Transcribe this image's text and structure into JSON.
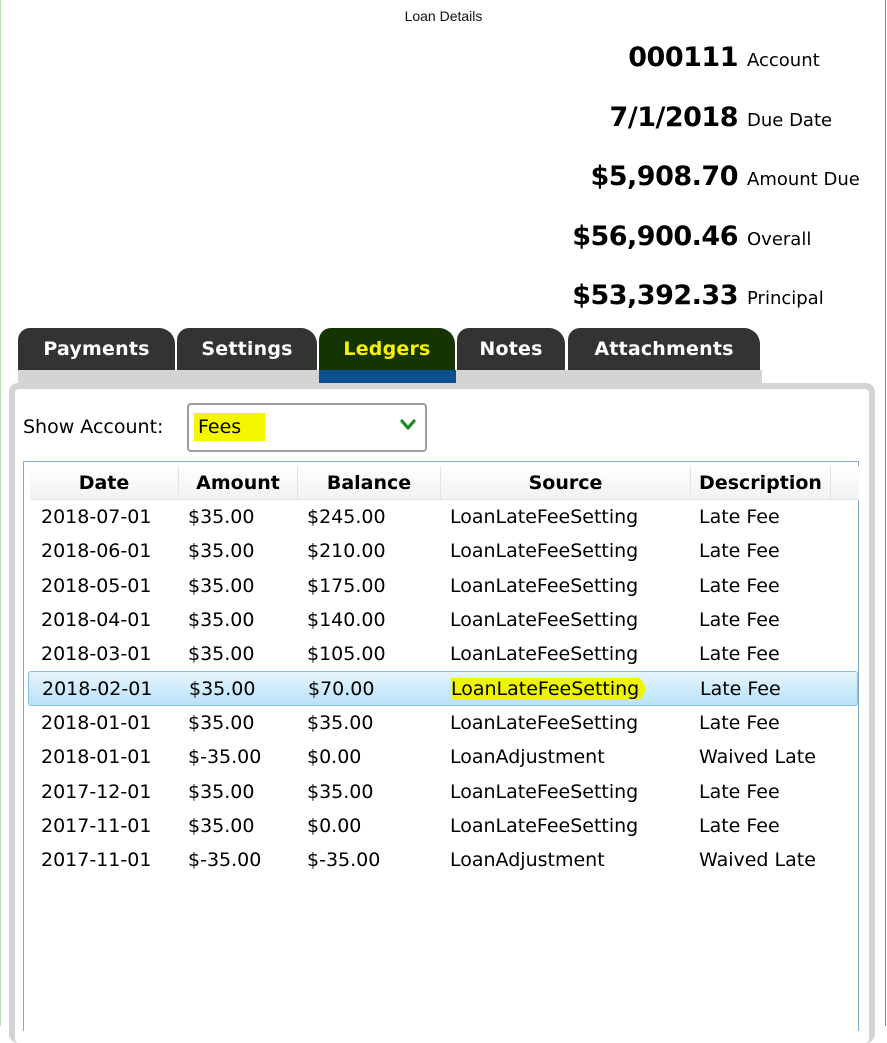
{
  "window": {
    "title": "Loan Details"
  },
  "summary": [
    {
      "value": "000111",
      "label": "Account"
    },
    {
      "value": "7/1/2018",
      "label": "Due Date"
    },
    {
      "value": "$5,908.70",
      "label": "Amount Due"
    },
    {
      "value": "$56,900.46",
      "label": "Overall"
    },
    {
      "value": "$53,392.33",
      "label": "Principal"
    }
  ],
  "tabs": [
    {
      "label": "Payments",
      "active": false
    },
    {
      "label": "Settings",
      "active": false
    },
    {
      "label": "Ledgers",
      "active": true
    },
    {
      "label": "Notes",
      "active": false
    },
    {
      "label": "Attachments",
      "active": false
    }
  ],
  "filter": {
    "label": "Show Account:",
    "selected": "Fees",
    "chevron_icon": "chevron-down-icon"
  },
  "ledger": {
    "columns": [
      "Date",
      "Amount",
      "Balance",
      "Source",
      "Description"
    ],
    "selected_row": 5,
    "rows": [
      {
        "date": "2018-07-01",
        "amount": "$35.00",
        "balance": "$245.00",
        "source": "LoanLateFeeSetting",
        "description": "Late Fee"
      },
      {
        "date": "2018-06-01",
        "amount": "$35.00",
        "balance": "$210.00",
        "source": "LoanLateFeeSetting",
        "description": "Late Fee"
      },
      {
        "date": "2018-05-01",
        "amount": "$35.00",
        "balance": "$175.00",
        "source": "LoanLateFeeSetting",
        "description": "Late Fee"
      },
      {
        "date": "2018-04-01",
        "amount": "$35.00",
        "balance": "$140.00",
        "source": "LoanLateFeeSetting",
        "description": "Late Fee"
      },
      {
        "date": "2018-03-01",
        "amount": "$35.00",
        "balance": "$105.00",
        "source": "LoanLateFeeSetting",
        "description": "Late Fee"
      },
      {
        "date": "2018-02-01",
        "amount": "$35.00",
        "balance": "$70.00",
        "source": "LoanLateFeeSetting",
        "description": "Late Fee"
      },
      {
        "date": "2018-01-01",
        "amount": "$35.00",
        "balance": "$35.00",
        "source": "LoanLateFeeSetting",
        "description": "Late Fee"
      },
      {
        "date": "2018-01-01",
        "amount": "$-35.00",
        "balance": "$0.00",
        "source": "LoanAdjustment",
        "description": "Waived Late"
      },
      {
        "date": "2017-12-01",
        "amount": "$35.00",
        "balance": "$35.00",
        "source": "LoanLateFeeSetting",
        "description": "Late Fee"
      },
      {
        "date": "2017-11-01",
        "amount": "$35.00",
        "balance": "$0.00",
        "source": "LoanLateFeeSetting",
        "description": "Late Fee"
      },
      {
        "date": "2017-11-01",
        "amount": "$-35.00",
        "balance": "$-35.00",
        "source": "LoanAdjustment",
        "description": "Waived Late"
      }
    ]
  },
  "colors": {
    "tab_bg": "#333333",
    "tab_active_bg": "#163402",
    "tab_active_text": "#f5f500",
    "tab_active_underline": "#0d4f8c",
    "highlight": "#f5f500",
    "selection": "#b9e2f8",
    "chevron": "#1e8a1e"
  }
}
